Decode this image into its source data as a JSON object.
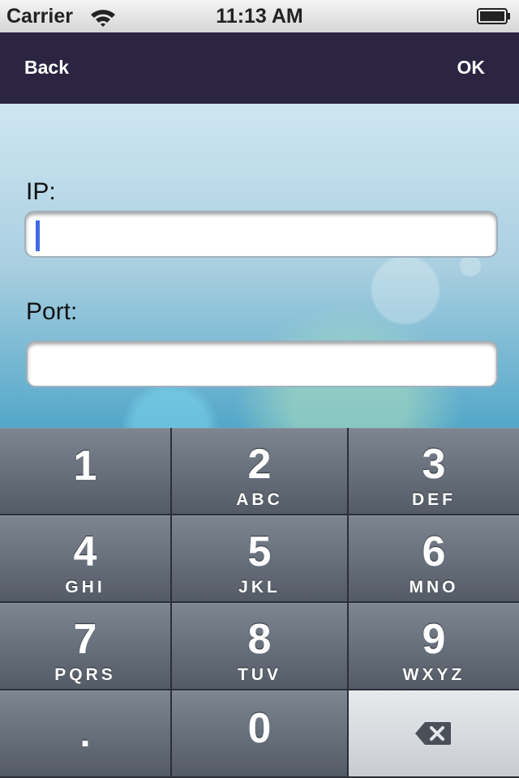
{
  "status_bar": {
    "carrier": "Carrier",
    "time": "11:13 AM",
    "icons": [
      "wifi-icon",
      "battery-icon"
    ]
  },
  "nav": {
    "back_label": "Back",
    "ok_label": "OK"
  },
  "form": {
    "ip_label": "IP:",
    "ip_value": "",
    "port_label": "Port:",
    "port_value": ""
  },
  "keypad": {
    "keys": [
      {
        "num": "1",
        "letters": ""
      },
      {
        "num": "2",
        "letters": "ABC"
      },
      {
        "num": "3",
        "letters": "DEF"
      },
      {
        "num": "4",
        "letters": "GHI"
      },
      {
        "num": "5",
        "letters": "JKL"
      },
      {
        "num": "6",
        "letters": "MNO"
      },
      {
        "num": "7",
        "letters": "PQRS"
      },
      {
        "num": "8",
        "letters": "TUV"
      },
      {
        "num": "9",
        "letters": "WXYZ"
      },
      {
        "num": "."
      },
      {
        "num": "0"
      }
    ],
    "delete_icon": "backspace-icon"
  },
  "colors": {
    "nav_bar": "#2b2542",
    "key_gradient_top": "#7d8591",
    "key_gradient_bottom": "#545b67",
    "cursor": "#3f6de6"
  }
}
